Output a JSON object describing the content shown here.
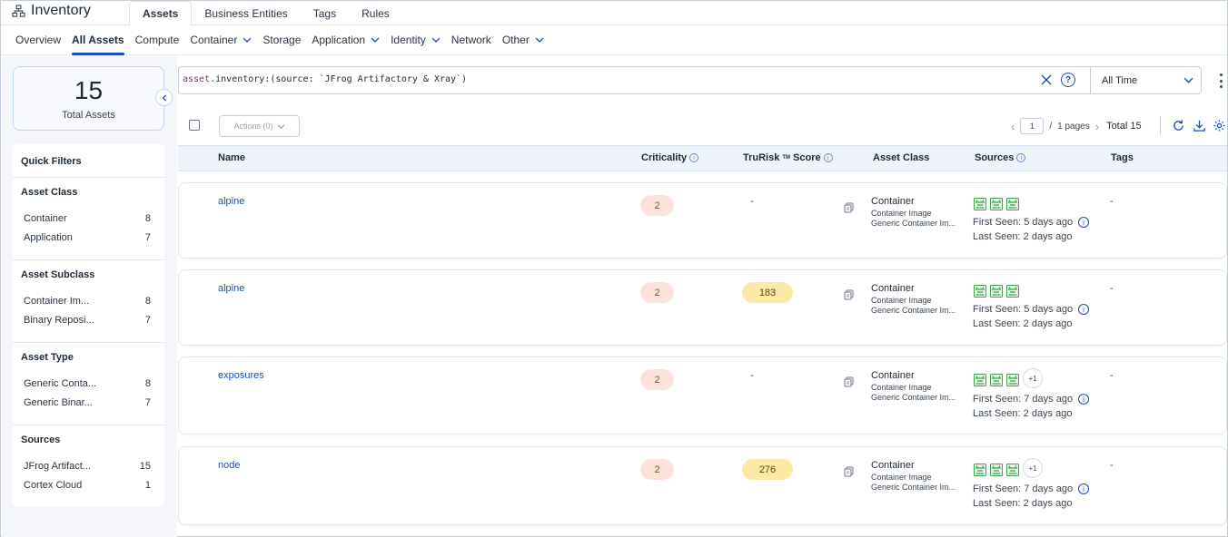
{
  "app": {
    "title": "Inventory",
    "icon": "hierarchy-icon"
  },
  "top_tabs": [
    {
      "label": "Assets",
      "active": true
    },
    {
      "label": "Business Entities",
      "active": false
    },
    {
      "label": "Tags",
      "active": false
    },
    {
      "label": "Rules",
      "active": false
    }
  ],
  "subnav": [
    {
      "label": "Overview",
      "dropdown": false,
      "active": false
    },
    {
      "label": "All Assets",
      "dropdown": false,
      "active": true
    },
    {
      "label": "Compute",
      "dropdown": false,
      "active": false
    },
    {
      "label": "Container",
      "dropdown": true,
      "active": false
    },
    {
      "label": "Storage",
      "dropdown": false,
      "active": false
    },
    {
      "label": "Application",
      "dropdown": true,
      "active": false
    },
    {
      "label": "Identity",
      "dropdown": true,
      "active": false
    },
    {
      "label": "Network",
      "dropdown": false,
      "active": false
    },
    {
      "label": "Other",
      "dropdown": true,
      "active": false
    }
  ],
  "summary": {
    "total": "15",
    "label": "Total Assets"
  },
  "quick_filters": {
    "title": "Quick Filters",
    "groups": [
      {
        "title": "Asset Class",
        "items": [
          {
            "label": "Container",
            "count": "8"
          },
          {
            "label": "Application",
            "count": "7"
          }
        ]
      },
      {
        "title": "Asset Subclass",
        "items": [
          {
            "label": "Container Im...",
            "count": "8"
          },
          {
            "label": "Binary Reposi...",
            "count": "7"
          }
        ]
      },
      {
        "title": "Asset Type",
        "items": [
          {
            "label": "Generic Conta...",
            "count": "8"
          },
          {
            "label": "Generic Binar...",
            "count": "7"
          }
        ]
      },
      {
        "title": "Sources",
        "items": [
          {
            "label": "JFrog Artifact...",
            "count": "15"
          },
          {
            "label": "Cortex Cloud",
            "count": "1"
          }
        ]
      }
    ]
  },
  "search": {
    "keyword": "asset",
    "query": ".inventory:(source: `JFrog Artifactory & Xray`)",
    "help": "?"
  },
  "time_filter": {
    "value": "All Time"
  },
  "toolbar": {
    "actions_label": "Actions (0)",
    "page_current": "1",
    "page_sep": "/",
    "pages_label": "1 pages",
    "total_label": "Total 15"
  },
  "columns": {
    "name": "Name",
    "criticality": "Criticality",
    "trurisk": "TruRisk",
    "trurisk_tm": "TM",
    "trurisk_suffix": "Score",
    "asset_class": "Asset Class",
    "sources": "Sources",
    "tags": "Tags"
  },
  "rows": [
    {
      "name": "alpine",
      "criticality": "2",
      "trurisk": "-",
      "class": "Container",
      "subclass": "Container Image",
      "type": "Generic Container Im...",
      "source_count": 3,
      "extra_sources": "",
      "first_seen": "First Seen: 5 days ago",
      "last_seen": "Last Seen: 2 days ago",
      "tags": "-"
    },
    {
      "name": "alpine",
      "criticality": "2",
      "trurisk": "183",
      "class": "Container",
      "subclass": "Container Image",
      "type": "Generic Container Im...",
      "source_count": 3,
      "extra_sources": "",
      "first_seen": "First Seen: 5 days ago",
      "last_seen": "Last Seen: 2 days ago",
      "tags": "-"
    },
    {
      "name": "exposures",
      "criticality": "2",
      "trurisk": "-",
      "class": "Container",
      "subclass": "Container Image",
      "type": "Generic Container Im...",
      "source_count": 3,
      "extra_sources": "+1",
      "first_seen": "First Seen: 7 days ago",
      "last_seen": "Last Seen: 2 days ago",
      "tags": "-"
    },
    {
      "name": "node",
      "criticality": "2",
      "trurisk": "276",
      "class": "Container",
      "subclass": "Container Image",
      "type": "Generic Container Im...",
      "source_count": 3,
      "extra_sources": "+1",
      "first_seen": "First Seen: 7 days ago",
      "last_seen": "Last Seen: 2 days ago",
      "tags": "-"
    }
  ],
  "colors": {
    "accent": "#1b4fb4",
    "criticality_bg": "#fbe3dc",
    "trurisk_bg": "#fbeaa6",
    "jfrog_green": "#3fa34d"
  }
}
